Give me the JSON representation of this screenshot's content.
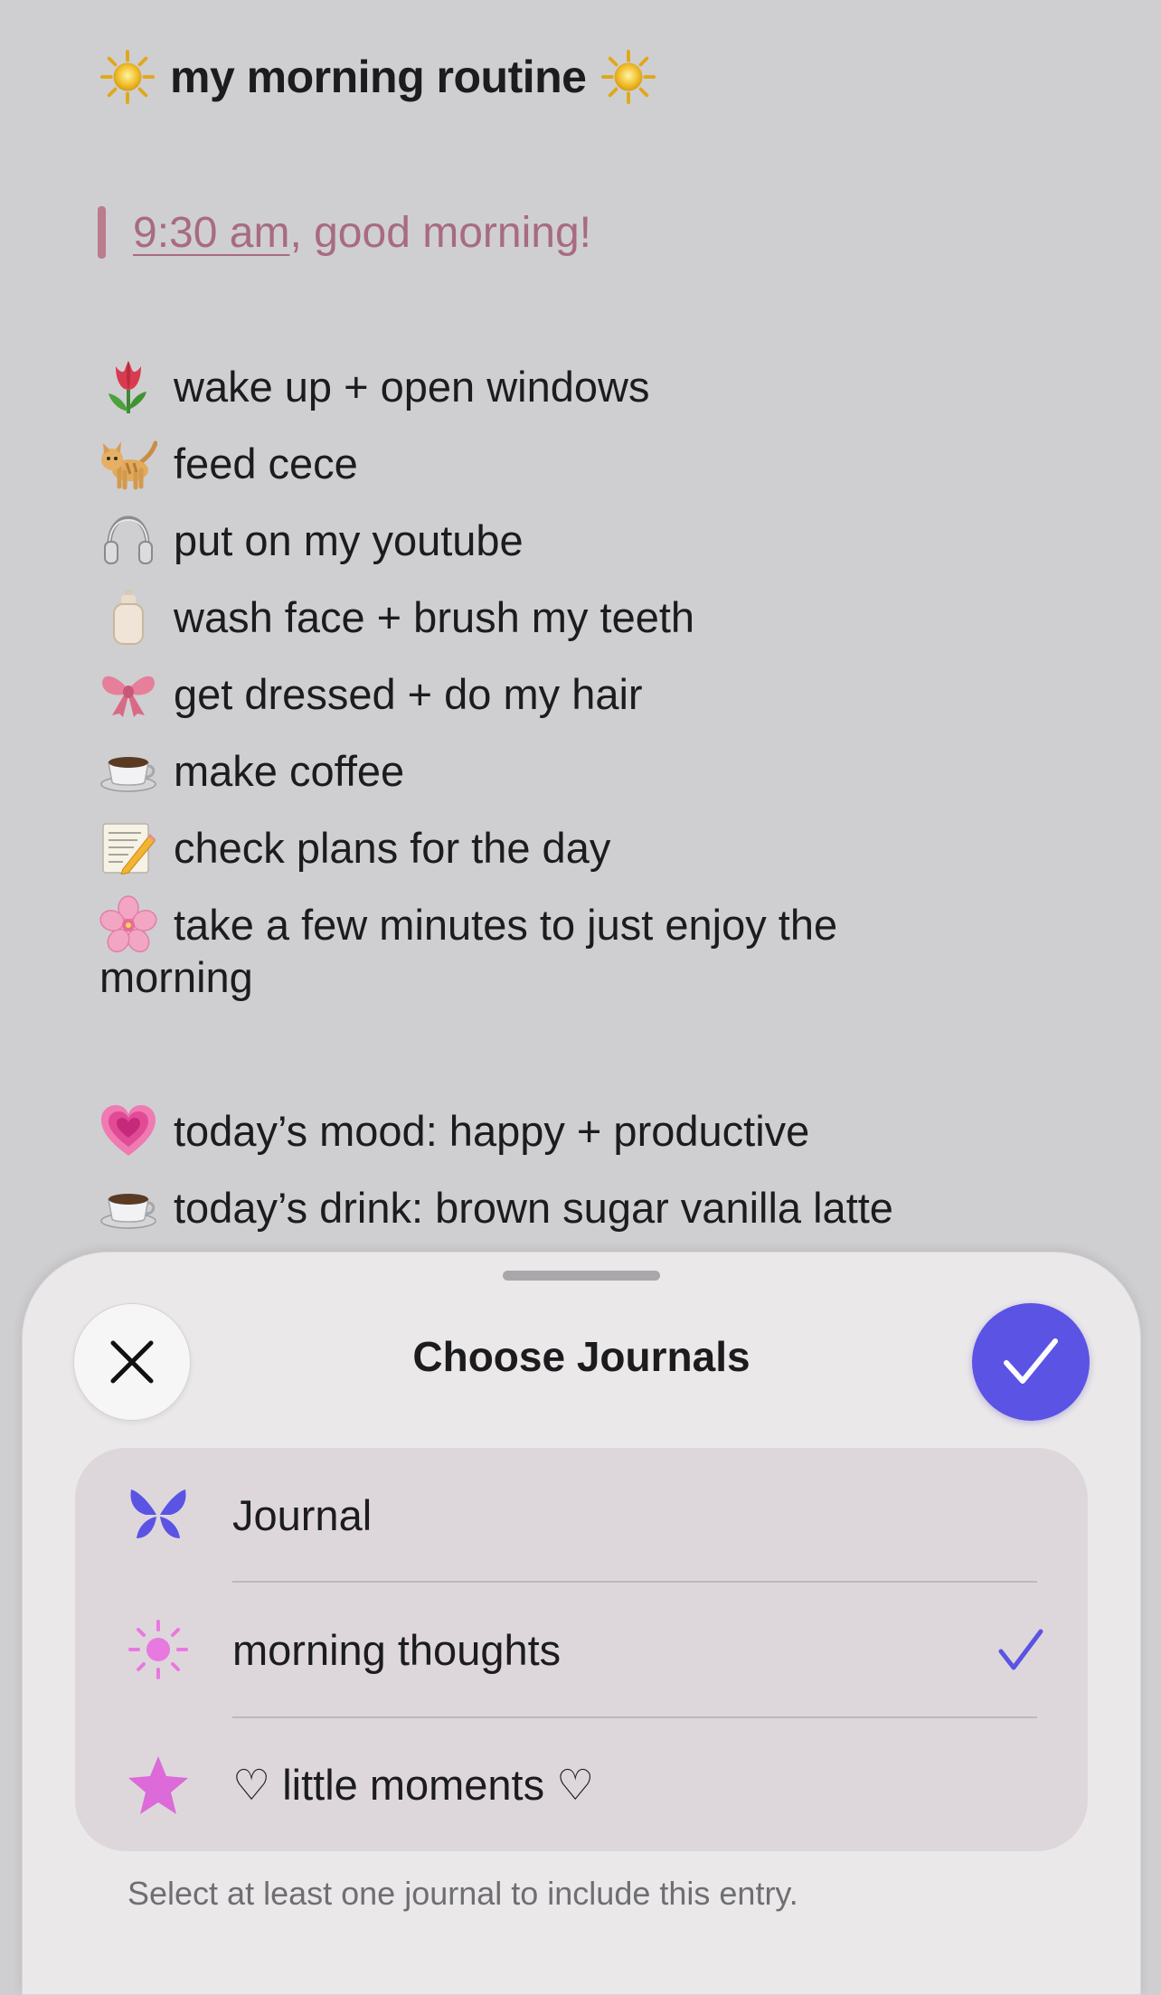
{
  "entry": {
    "title": "my morning routine",
    "title_icon": "sun-emoji",
    "quote_time": "9:30 am",
    "quote_rest": ", good morning!",
    "items": [
      {
        "icon": "tulip-emoji",
        "text": "wake up + open windows"
      },
      {
        "icon": "cat-emoji",
        "text": "feed cece"
      },
      {
        "icon": "headphones-emoji",
        "text": "put on my youtube"
      },
      {
        "icon": "lotion-bottle-emoji",
        "text": "wash face + brush my teeth"
      },
      {
        "icon": "ribbon-emoji",
        "text": "get dressed + do my hair"
      },
      {
        "icon": "coffee-emoji",
        "text": "make coffee"
      },
      {
        "icon": "memo-emoji",
        "text": "check plans for the day"
      },
      {
        "icon": "cherry-blossom-emoji",
        "text": "take a few minutes to just enjoy the",
        "continuation": "morning"
      }
    ],
    "mood": {
      "icon": "growing-heart-emoji",
      "text": "today’s mood: happy + productive"
    },
    "drink": {
      "icon": "coffee-emoji",
      "text": "today’s drink: brown sugar vanilla latte"
    }
  },
  "sheet": {
    "title": "Choose Journals",
    "close_icon": "close-icon",
    "done_icon": "checkmark-icon",
    "journals": [
      {
        "label": "Journal",
        "icon": "butterfly-icon",
        "selected": false
      },
      {
        "label": "morning thoughts",
        "icon": "sun-icon",
        "selected": true
      },
      {
        "label": "♡ little moments ♡",
        "icon": "star-icon",
        "selected": false
      }
    ],
    "footnote": "Select at least one journal to include this entry."
  },
  "colors": {
    "accent": "#5a53e4",
    "quote": "#a86b80",
    "background": "#cfcfd2",
    "sheet": "#ebe8ea",
    "butterfly": "#5a53e4",
    "sun_pink": "#e879e0",
    "star_pink": "#dc6ad8"
  }
}
